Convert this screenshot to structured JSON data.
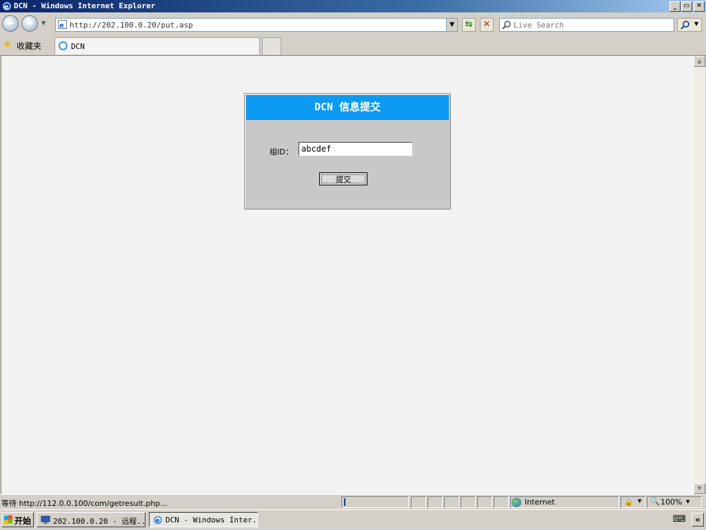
{
  "window": {
    "title": "DCN - Windows Internet Explorer",
    "minimize": "_",
    "restore": "▭",
    "close": "✕"
  },
  "nav": {
    "back": "←",
    "forward": "→",
    "address": "http://202.100.0.20/put.asp",
    "search_placeholder": "Live Search"
  },
  "favorites": {
    "label": "收藏夹"
  },
  "tabs": [
    {
      "label": "DCN"
    }
  ],
  "form": {
    "title": "DCN 信息提交",
    "group_label": "组ID：",
    "group_value": "abcdef",
    "submit_label": "提交"
  },
  "status": {
    "text": "等待 http://112.0.0.100/com/getresult.php...",
    "zone": "Internet",
    "zoom": "100%"
  },
  "taskbar": {
    "start": "开始",
    "tasks": [
      {
        "label": "202.100.0.20 - 远程..."
      },
      {
        "label": "DCN - Windows Inter..."
      }
    ],
    "show_more": "«"
  },
  "colors": {
    "panel_header": "#0d9af2",
    "panel_body": "#c8c8c8",
    "page_background": "#f2f2f2"
  }
}
